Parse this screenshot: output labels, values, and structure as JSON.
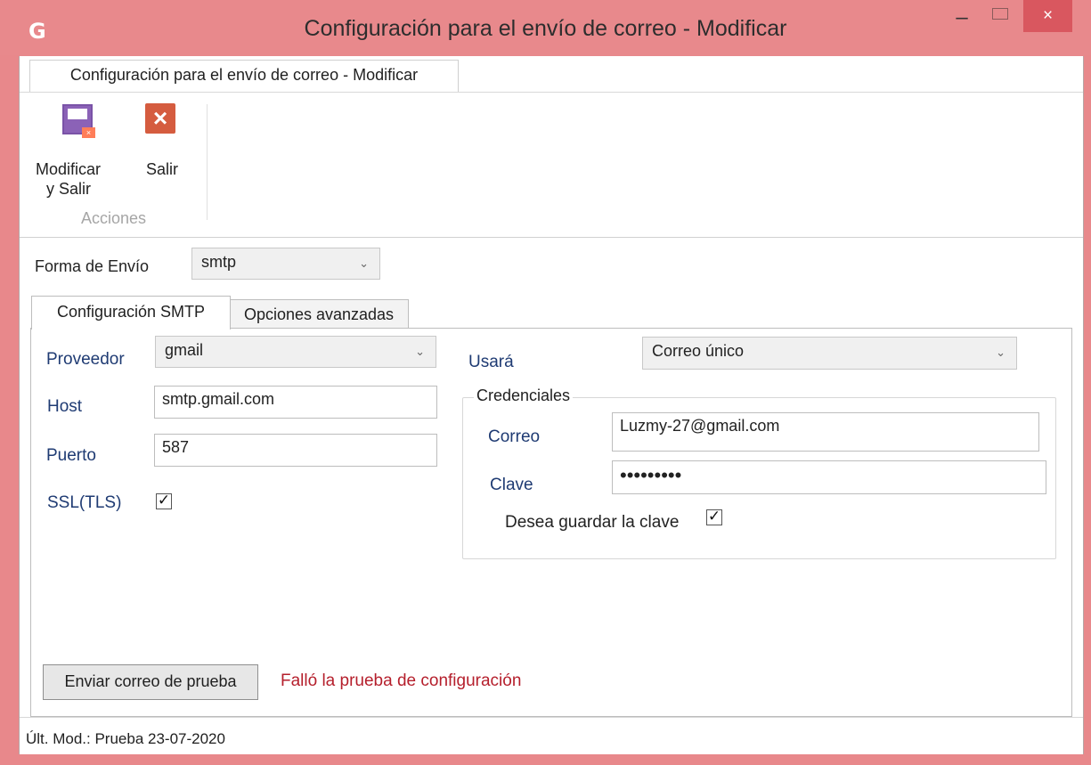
{
  "window": {
    "app_icon": "G",
    "title": "Configuración para el envío de correo - Modificar",
    "minimize": "–",
    "close": "×"
  },
  "ribbon": {
    "tab_label": "Configuración para el envío de correo - Modificar",
    "actions": {
      "modify_exit_label_line1": "Modificar",
      "modify_exit_label_line2": "y Salir",
      "exit_label": "Salir",
      "group_label": "Acciones"
    }
  },
  "send_method": {
    "label": "Forma de Envío",
    "value": "smtp"
  },
  "tabs": [
    {
      "label": "Configuración SMTP"
    },
    {
      "label": "Opciones avanzadas"
    }
  ],
  "smtp": {
    "provider_label": "Proveedor",
    "provider_value": "gmail",
    "host_label": "Host",
    "host_value": "smtp.gmail.com",
    "port_label": "Puerto",
    "port_value": "587",
    "ssl_label": "SSL(TLS)",
    "ssl_checked": true,
    "use_label": "Usará",
    "use_value": "Correo único",
    "credentials_label": "Credenciales",
    "email_label": "Correo",
    "email_value": "Luzmy-27@gmail.com",
    "password_label": "Clave",
    "password_value": "•••••••••",
    "save_password_label": "Desea guardar la clave",
    "save_password_checked": true
  },
  "test": {
    "button_label": "Enviar correo de prueba",
    "error_message": "Falló la prueba de configuración"
  },
  "status_bar": {
    "text": "Últ. Mod.:  Prueba  23-07-2020"
  }
}
